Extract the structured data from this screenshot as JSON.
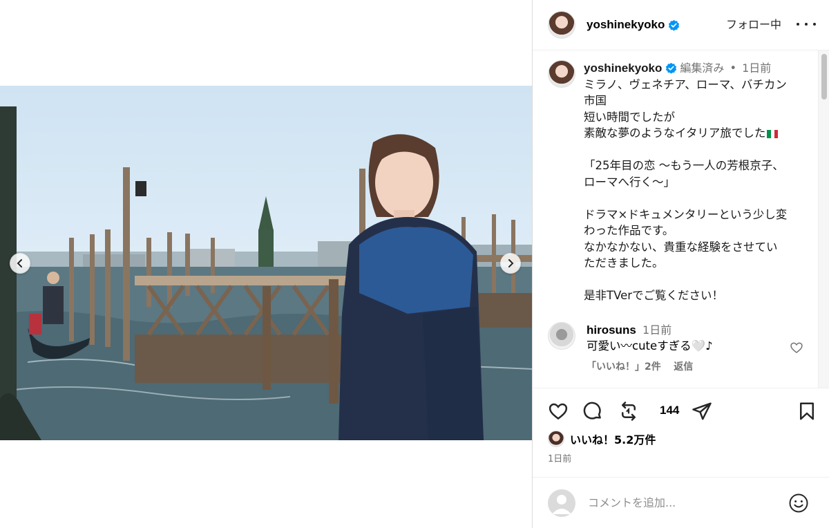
{
  "post": {
    "author": "yoshinekyoko",
    "verified_icon": "verified-badge-icon",
    "follow_label": "フォロー中",
    "more_icon": "more-options-icon",
    "photo_alt": "",
    "carousel": {
      "prev_icon": "chevron-left-icon",
      "next_icon": "chevron-right-icon"
    }
  },
  "caption": {
    "username": "yoshinekyoko",
    "edited": "編集済み",
    "separator": "•",
    "time": "1日前",
    "lines": [
      "ミラノ、ヴェネチア、ローマ、バチカン",
      "市国",
      "短い時間でしたが",
      "素敵な夢のようなイタリア旅でした",
      "",
      "「25年目の恋 〜もう一人の芳根京子、",
      "ローマへ行く〜」",
      "",
      "ドラマ×ドキュメンタリーという少し変",
      "わった作品です。",
      "なかなかない、貴重な経験をさせてい",
      "ただきました。",
      "",
      "是非TVerでご覧ください！"
    ],
    "flag_icon": "italy-flag-icon",
    "flag_colors": [
      "#009246",
      "#ffffff",
      "#ce2b37"
    ]
  },
  "comments": [
    {
      "username": "hirosuns",
      "time": "1日前",
      "text": "可愛い〰cuteすぎる🤍♪",
      "likes_label": "「いいね！」2件",
      "reply_label": "返信"
    }
  ],
  "actions": {
    "repost_count": "144",
    "likes_label": "いいね！5.2万件",
    "post_time": "1日前"
  },
  "add_comment": {
    "placeholder": "コメントを追加..."
  },
  "colors": {
    "verified": "#0095f6",
    "secondary_text": "#737373",
    "border": "#dbdbdb"
  }
}
